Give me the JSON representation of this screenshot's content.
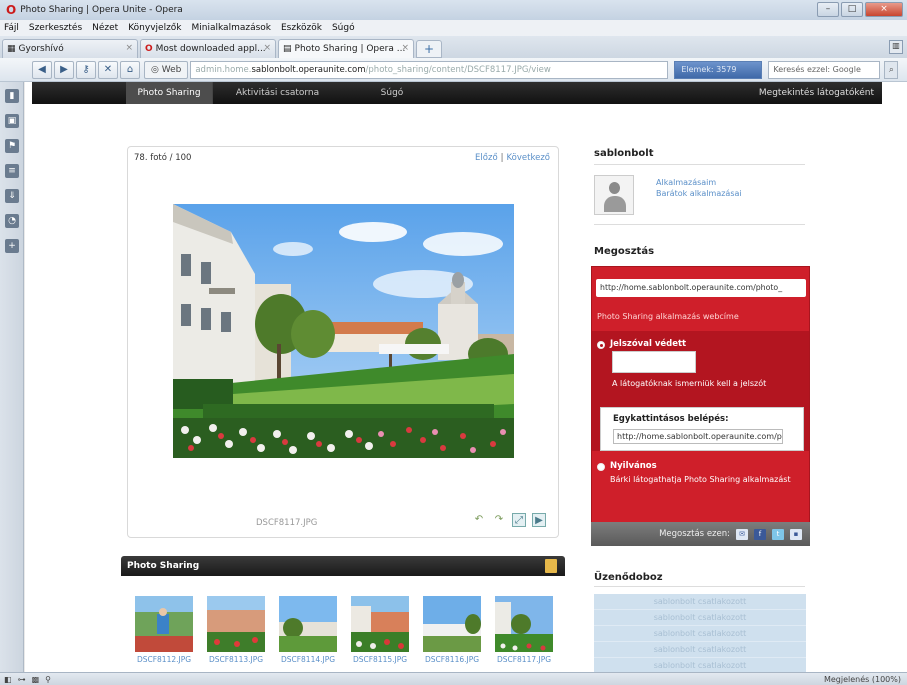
{
  "window": {
    "title": "Photo Sharing | Opera Unite - Opera",
    "buttons": [
      "–",
      "□",
      "×"
    ]
  },
  "menu": [
    "Fájl",
    "Szerkesztés",
    "Nézet",
    "Könyvjelzők",
    "Minialkalmazások",
    "Eszközök",
    "Súgó"
  ],
  "tabs": [
    {
      "label": "Gyorshívó"
    },
    {
      "label": "Most downloaded appl..."
    },
    {
      "label": "Photo Sharing | Opera ..."
    }
  ],
  "address": {
    "web_label": "Web",
    "url_prefix": "admin.home.",
    "url_host": "sablonbolt.operaunite.com",
    "url_path": "/photo_sharing/content/DSCF8117.JPG/view",
    "history": "Elemek: 3579",
    "search_placeholder": "Keresés ezzel: Google"
  },
  "unite_nav": {
    "tabs": [
      "Photo Sharing",
      "Aktivitási csatorna",
      "Súgó"
    ],
    "right": "Megtekintés látogatóként"
  },
  "photo": {
    "counter": "78. fotó / 100",
    "prev": "Előző",
    "separator": "|",
    "next": "Következő",
    "filename": "DSCF8117.JPG"
  },
  "gallery": {
    "title": "Photo Sharing",
    "thumbs": [
      "DSCF8112.JPG",
      "DSCF8113.JPG",
      "DSCF8114.JPG",
      "DSCF8115.JPG",
      "DSCF8116.JPG",
      "DSCF8117.JPG"
    ]
  },
  "profile": {
    "username": "sablonbolt",
    "my_apps": "Alkalmazásaim",
    "friends_apps": "Barátok alkalmazásai"
  },
  "sharing": {
    "title": "Megosztás",
    "url": "http://home.sablonbolt.operaunite.com/photo_",
    "webcim": "Photo Sharing alkalmazás webcíme",
    "opt1_label": "Jelszóval védett",
    "opt1_desc": "A látogatóknak ismerniük kell a jelszót",
    "onclick_title": "Egykattintásos belépés:",
    "onclick_url": "http://home.sablonbolt.operaunite.com/p",
    "opt2_label": "Nyilvános",
    "opt2_desc": "Bárki látogathatja Photo Sharing alkalmazást",
    "share_on": "Megosztás ezen:"
  },
  "messages": {
    "title": "Üzenődoboz",
    "lines": [
      "sablonbolt csatlakozott",
      "sablonbolt csatlakozott",
      "sablonbolt csatlakozott",
      "sablonbolt csatlakozott",
      "sablonbolt csatlakozott"
    ]
  },
  "status": {
    "zoom": "Megjelenés (100%)"
  },
  "colors": {
    "share_red": "#cf1f2a",
    "link_blue": "#5a8fc8",
    "nav_dark": "#1a1a1a"
  }
}
